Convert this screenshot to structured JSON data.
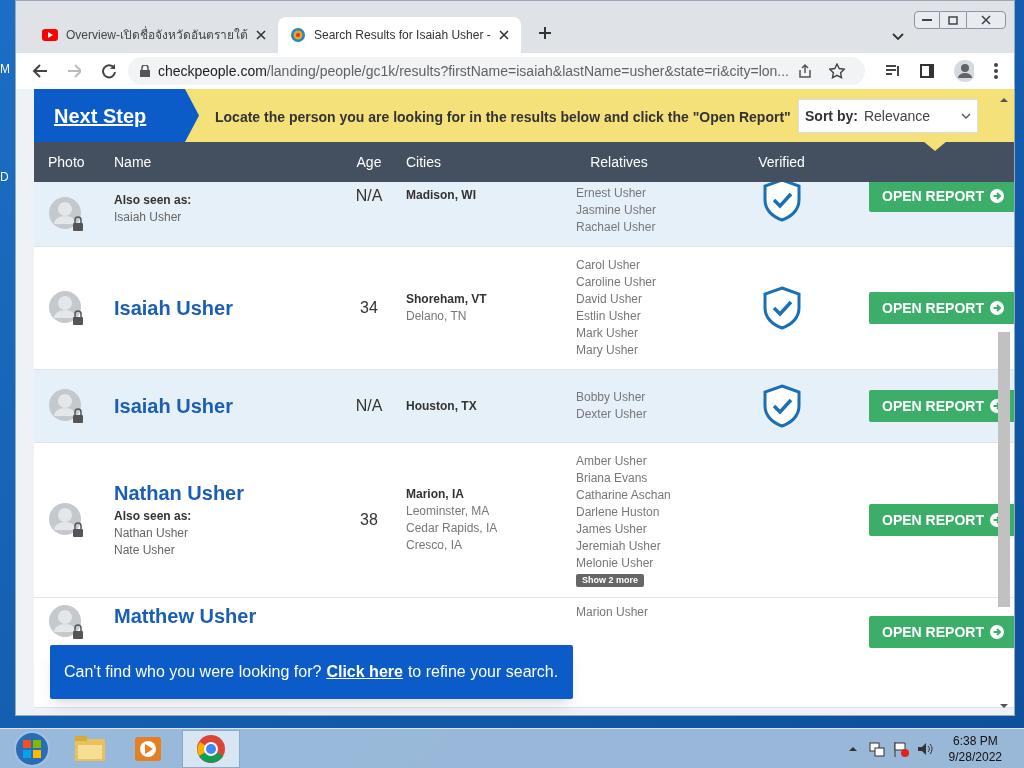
{
  "desktop_labels": [
    "M",
    "D"
  ],
  "tabs": [
    {
      "title": "Overview-เปิดชื่อจังหวัดอันตรายใต้",
      "selected": false
    },
    {
      "title": "Search Results for Isaiah Usher -",
      "selected": true
    }
  ],
  "address_bar": {
    "domain": "checkpeople.com",
    "path": "/landing/people/gc1k/results?firstName=isaiah&lastName=usher&state=ri&city=lon..."
  },
  "banner": {
    "step": "Next Step",
    "message": "Locate the person you are looking for in the results below and click the \"Open Report\"",
    "sort_label": "Sort by:",
    "sort_value": "Relevance"
  },
  "table": {
    "columns": [
      "Photo",
      "Name",
      "Age",
      "Cities",
      "Relatives",
      "Verified"
    ],
    "rows": [
      {
        "name": "",
        "also_seen_label": "Also seen as:",
        "aliases": [
          "Isaiah Usher"
        ],
        "age": "N/A",
        "cities": [
          "Madison, WI"
        ],
        "relatives": [
          "Ernest Usher",
          "Jasmine Usher",
          "Rachael Usher"
        ],
        "verified": true,
        "button": "OPEN REPORT",
        "shaded": true
      },
      {
        "name": "Isaiah Usher",
        "aliases": [],
        "age": "34",
        "cities": [
          "Shoreham, VT",
          "Delano, TN"
        ],
        "relatives": [
          "Carol Usher",
          "Caroline Usher",
          "David Usher",
          "Estlin Usher",
          "Mark Usher",
          "Mary Usher"
        ],
        "verified": true,
        "button": "OPEN REPORT",
        "shaded": false
      },
      {
        "name": "Isaiah Usher",
        "aliases": [],
        "age": "N/A",
        "cities": [
          "Houston, TX"
        ],
        "relatives": [
          "Bobby Usher",
          "Dexter Usher"
        ],
        "verified": true,
        "button": "OPEN REPORT",
        "shaded": true
      },
      {
        "name": "Nathan Usher",
        "also_seen_label": "Also seen as:",
        "aliases": [
          "Nathan Usher",
          "Nate Usher"
        ],
        "age": "38",
        "cities": [
          "Marion, IA",
          "Leominster, MA",
          "Cedar Rapids, IA",
          "Cresco, IA"
        ],
        "relatives": [
          "Amber Usher",
          "Briana Evans",
          "Catharine Aschan",
          "Darlene Huston",
          "James Usher",
          "Jeremiah Usher",
          "Melonie Usher"
        ],
        "more": "Show 2 more",
        "verified": false,
        "button": "OPEN REPORT",
        "shaded": false
      },
      {
        "name": "Matthew Usher",
        "aliases": [],
        "age": "",
        "cities": [],
        "relatives": [
          "Marion Usher"
        ],
        "verified": false,
        "button": "OPEN REPORT",
        "shaded": false
      }
    ]
  },
  "refine_banner": {
    "before": "Can't find who you were looking for?",
    "link": "Click here",
    "after": "to refine your search."
  },
  "clock": {
    "time": "6:38 PM",
    "date": "9/28/2022"
  }
}
